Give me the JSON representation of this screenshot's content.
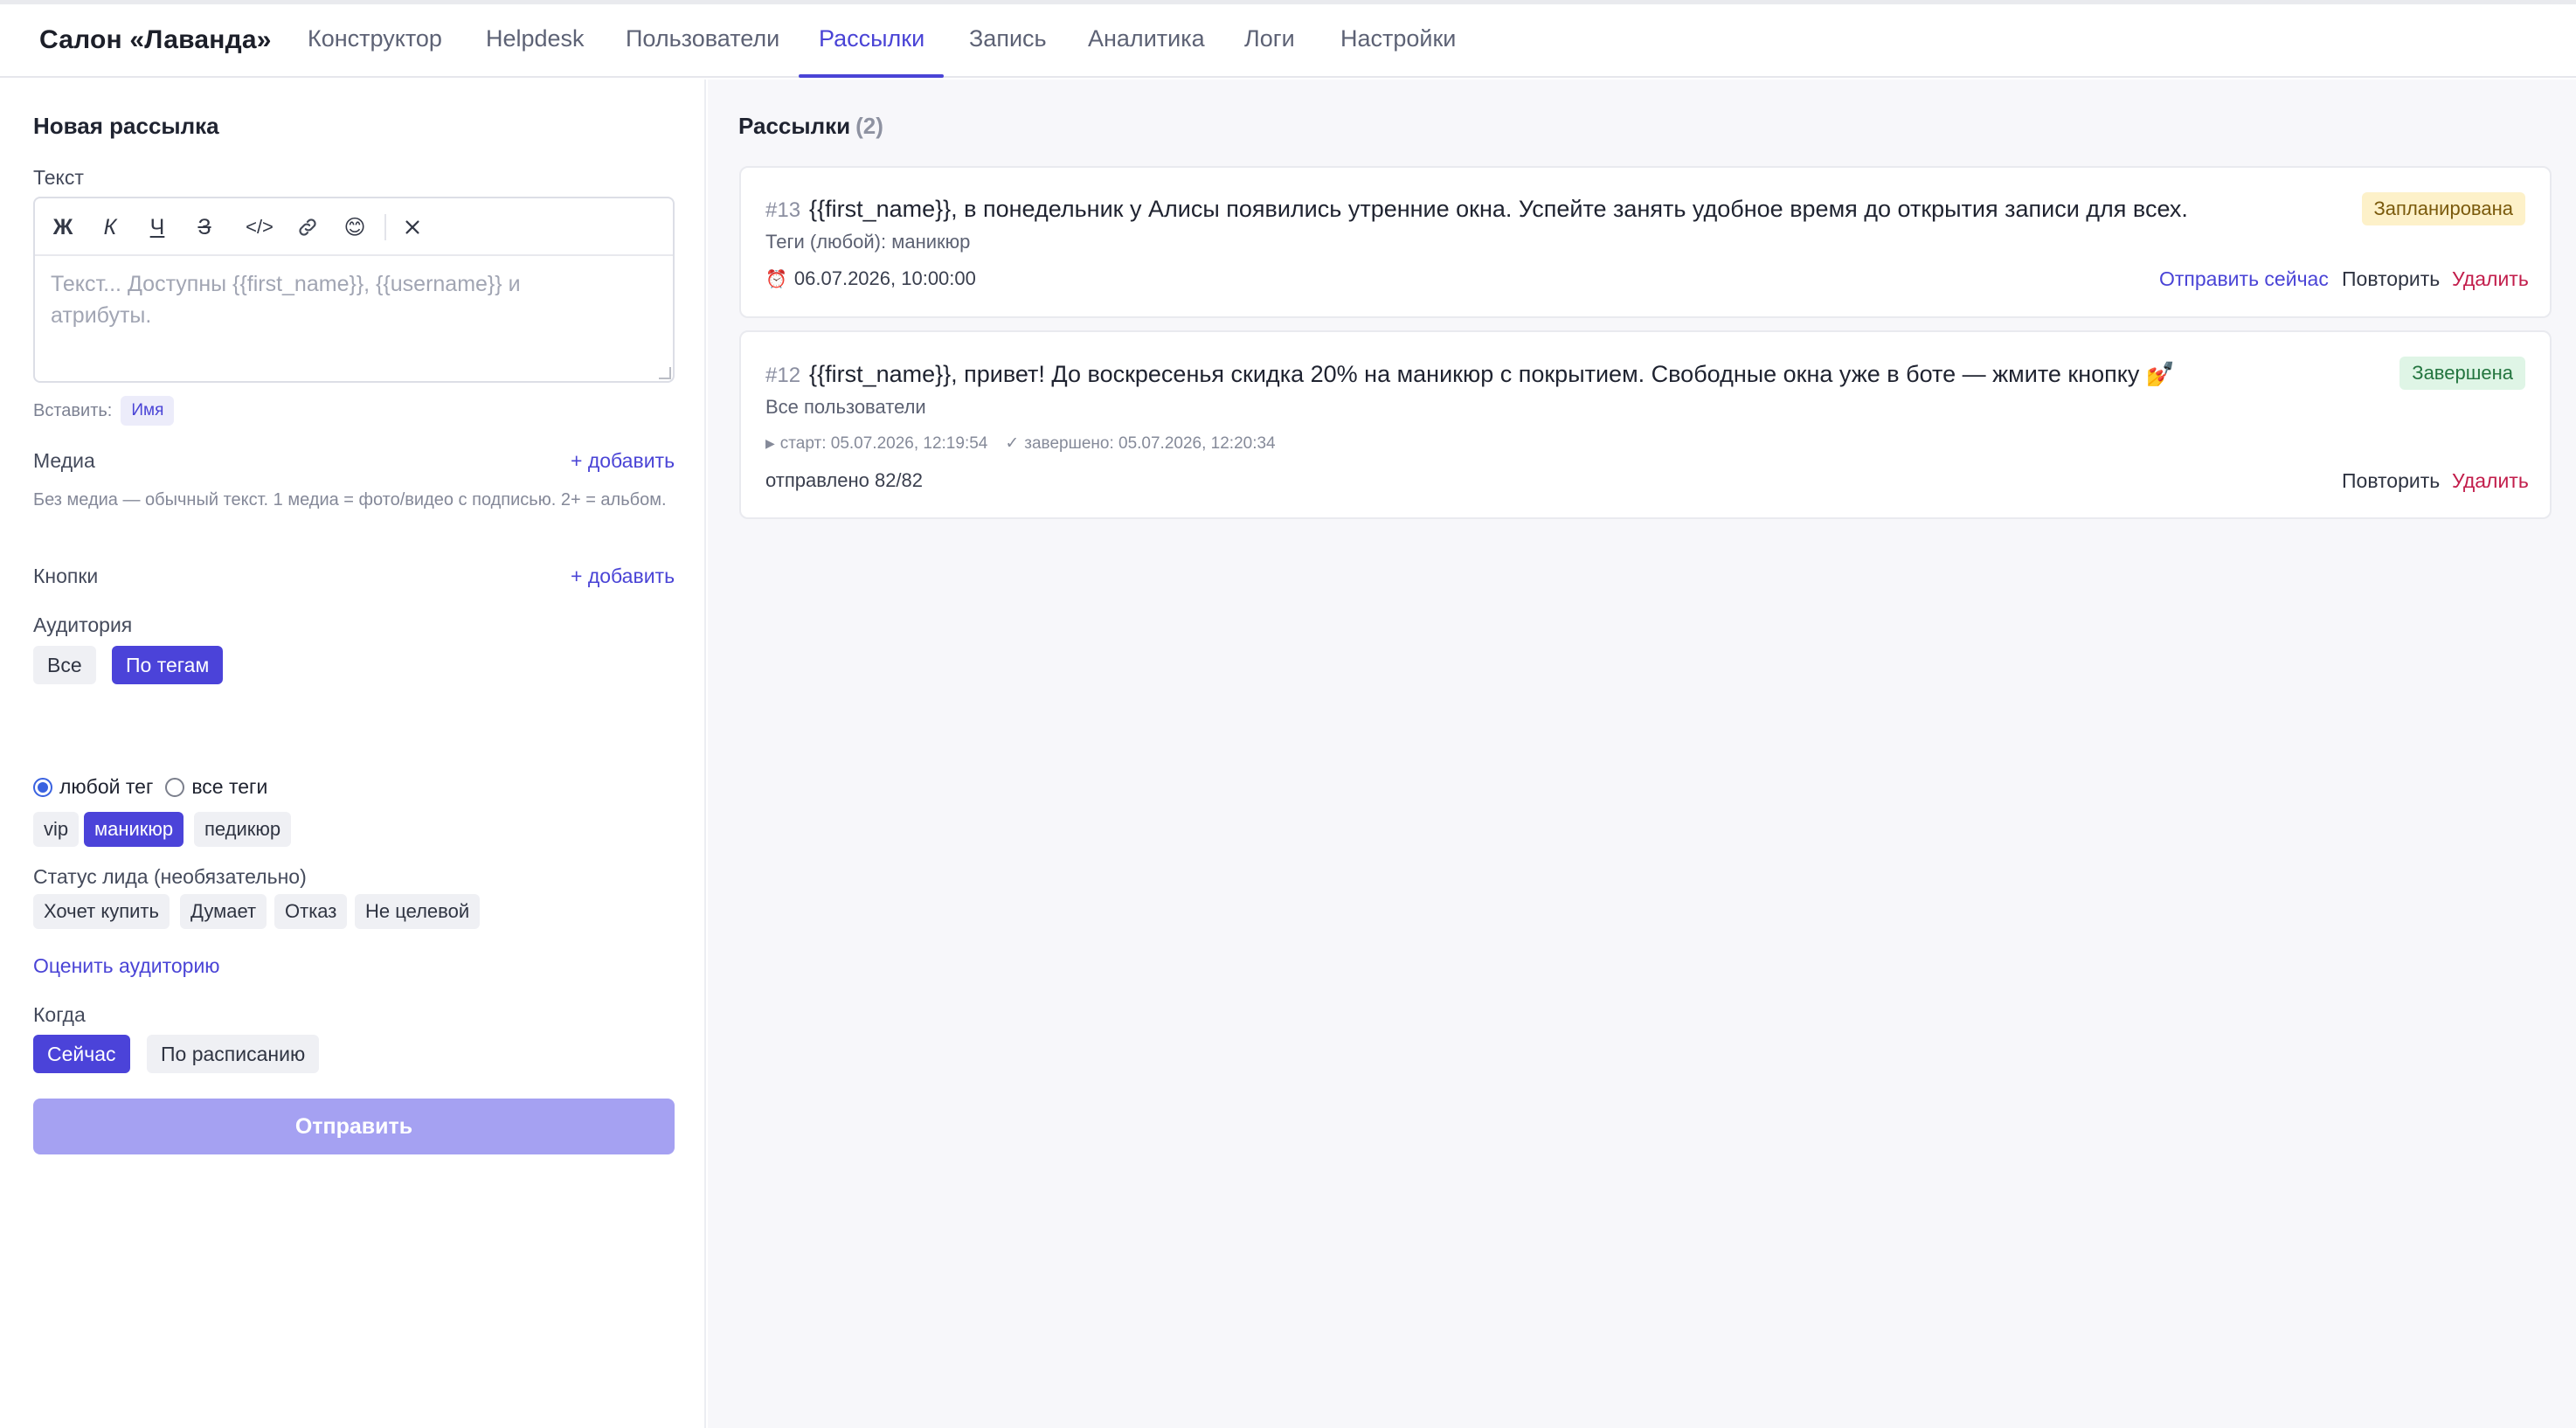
{
  "nav": {
    "brand": "Салон «Лаванда»",
    "tabs": [
      {
        "label": "Конструктор"
      },
      {
        "label": "Helpdesk"
      },
      {
        "label": "Пользователи"
      },
      {
        "label": "Рассылки"
      },
      {
        "label": "Запись"
      },
      {
        "label": "Аналитика"
      },
      {
        "label": "Логи"
      },
      {
        "label": "Настройки"
      }
    ],
    "active_tab": "Рассылки"
  },
  "form": {
    "title": "Новая рассылка",
    "text_label": "Текст",
    "toolbar": [
      "Ж",
      "К",
      "Ч",
      "З",
      "</>",
      "link-icon",
      "smile-icon",
      "clear-format-icon"
    ],
    "placeholder": "Текст... Доступны {{first_name}}, {{username}} и атрибуты.",
    "insert_label": "Вставить:",
    "insert_chip": "Имя",
    "media_label": "Медиа",
    "add_label": "+ добавить",
    "media_hint": "Без медиа — обычный текст. 1 медиа = фото/видео с подписью. 2+ = альбом.",
    "buttons_label": "Кнопки",
    "audience_label": "Аудитория",
    "audience_options": [
      "Все",
      "По тегам"
    ],
    "audience_selected": "По тегам",
    "tag_mode": {
      "any": "любой тег",
      "all": "все теги",
      "selected": "любой тег"
    },
    "tags": [
      "vip",
      "маникюр",
      "педикюр"
    ],
    "selected_tag": "маникюр",
    "lead_status_label": "Статус лида (необязательно)",
    "lead_statuses": [
      "Хочет купить",
      "Думает",
      "Отказ",
      "Не целевой"
    ],
    "estimate_link": "Оценить аудиторию",
    "when_label": "Когда",
    "when_options": [
      "Сейчас",
      "По расписанию"
    ],
    "when_selected": "Сейчас",
    "send_label": "Отправить"
  },
  "list": {
    "title": "Рассылки",
    "count": "(2)",
    "items": [
      {
        "id": "#13",
        "text": "{{first_name}}, в понедельник у Алисы появились утренние окна. Успейте занять удобное время до открытия записи для всех.",
        "audience": "Теги (любой): маникюр",
        "scheduled": "06.07.2026, 10:00:00",
        "status": "Запланирована",
        "actions": [
          "Отправить сейчас",
          "Повторить",
          "Удалить"
        ]
      },
      {
        "id": "#12",
        "text": "{{first_name}}, привет! До воскресенья скидка 20% на маникюр с покрытием. Свободные окна уже в боте — жмите кнопку 💅",
        "audience": "Все пользователи",
        "started": "старт: 05.07.2026, 12:19:54",
        "finished": "завершено: 05.07.2026, 12:20:34",
        "sent": "отправлено 82/82",
        "status": "Завершена",
        "actions": [
          "Повторить",
          "Удалить"
        ]
      }
    ]
  },
  "colors": {
    "accent": "#4b43d9",
    "accent_disabled": "#a5a1f2",
    "danger": "#c21d4b",
    "badge_planned_bg": "#fdf1c9",
    "badge_done_bg": "#dff5e6"
  }
}
